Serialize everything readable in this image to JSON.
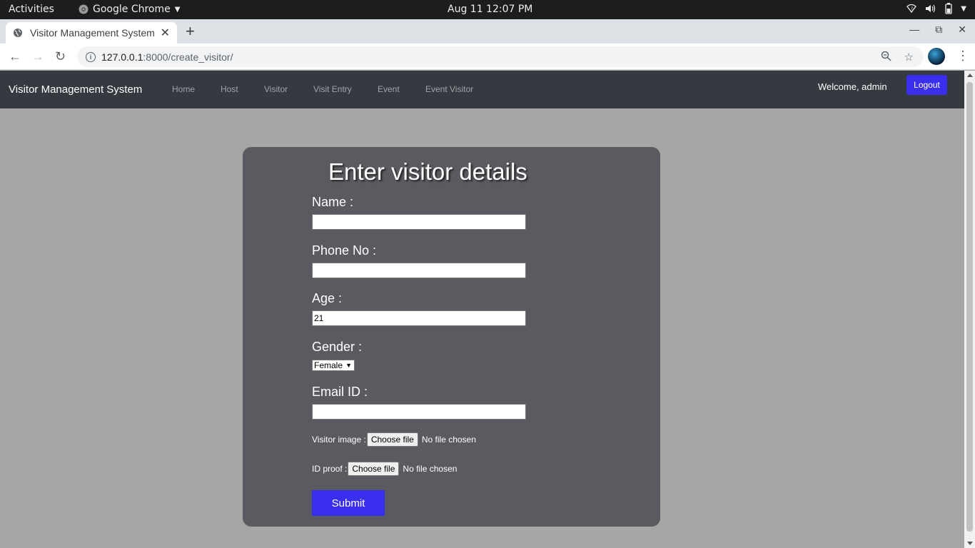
{
  "os_topbar": {
    "activities": "Activities",
    "app_name": "Google Chrome",
    "clock": "Aug 11  12:07 PM"
  },
  "browser": {
    "tab_title": "Visitor Management System",
    "url_host": "127.0.0.1",
    "url_path": ":8000/create_visitor/"
  },
  "navbar": {
    "brand": "Visitor Management System",
    "links": [
      "Home",
      "Host",
      "Visitor",
      "Visit Entry",
      "Event",
      "Event Visitor"
    ],
    "welcome": "Welcome, admin",
    "logout": "Logout"
  },
  "form": {
    "title": "Enter visitor details",
    "name_label": "Name :",
    "name_value": "",
    "phone_label": "Phone No :",
    "phone_value": "",
    "age_label": "Age :",
    "age_value": "21",
    "gender_label": "Gender :",
    "gender_value": "Female",
    "email_label": "Email ID :",
    "email_value": "",
    "visitor_image_label": "Visitor image :",
    "id_proof_label": "ID proof :",
    "choose_file": "Choose file",
    "no_file": "No file chosen",
    "submit": "Submit"
  },
  "colors": {
    "accent": "#3a2fef",
    "navbar_bg": "#343a40",
    "card_bg": "#5b5a60",
    "page_bg": "#a6a6a6"
  }
}
